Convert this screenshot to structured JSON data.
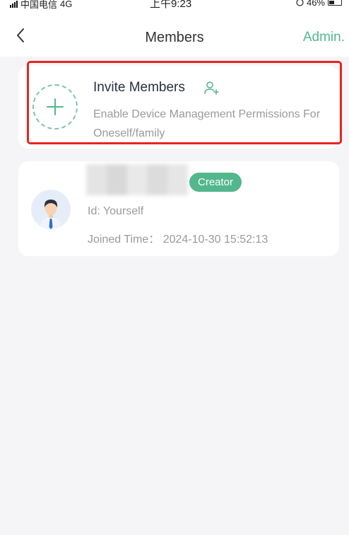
{
  "status_bar": {
    "carrier": "中国电信",
    "network": "4G",
    "time": "上午9:23",
    "battery_text": "46%",
    "battery_level": 0.46
  },
  "nav": {
    "back_icon": "chevron-left-icon",
    "title": "Members",
    "admin_label": "Admin."
  },
  "invite": {
    "title": "Invite Members",
    "description": "Enable Device Management Permissions For Oneself/family",
    "icon": "add-user-icon",
    "plus_icon": "plus-icon"
  },
  "member": {
    "name": "",
    "badge": "Creator",
    "id_label": "Id:",
    "id_value": "Yourself",
    "joined_label": "Joined Time：",
    "joined_value": "2024-10-30 15:52:13"
  },
  "colors": {
    "accent": "#52b78b",
    "highlight": "#e8251f",
    "background": "#f5f5f7",
    "muted_text": "#9a9a9a"
  }
}
